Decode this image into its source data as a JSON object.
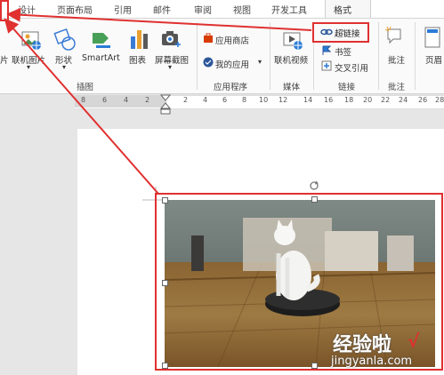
{
  "tabs": {
    "design": "设计",
    "layout": "页面布局",
    "references": "引用",
    "mailings": "邮件",
    "review": "审阅",
    "view": "视图",
    "developer": "开发工具",
    "format": "格式"
  },
  "ribbon": {
    "picture_partial": "片",
    "online_pictures": "联机图片",
    "shapes": "形状",
    "smartart": "SmartArt",
    "chart": "图表",
    "screenshot": "屏幕截图",
    "app_store": "应用商店",
    "my_apps": "我的应用",
    "online_video": "联机视频",
    "hyperlink": "超链接",
    "bookmark": "书签",
    "cross_reference": "交叉引用",
    "comment": "批注",
    "header_partial": "页眉"
  },
  "groups": {
    "illustrations": "插图",
    "apps": "应用程序",
    "media": "媒体",
    "links": "链接",
    "comments": "批注"
  },
  "ruler": [
    "8",
    "6",
    "4",
    "2",
    "2",
    "4",
    "6",
    "8",
    "10",
    "12",
    "14",
    "16",
    "18",
    "20",
    "22",
    "24",
    "26",
    "28",
    "30"
  ],
  "watermark": {
    "title": "经验啦",
    "url": "jingyanla.com"
  },
  "colors": {
    "annotation_red": "#e03030",
    "ribbon_bg": "#fafafa",
    "accent_blue": "#2b579a"
  }
}
